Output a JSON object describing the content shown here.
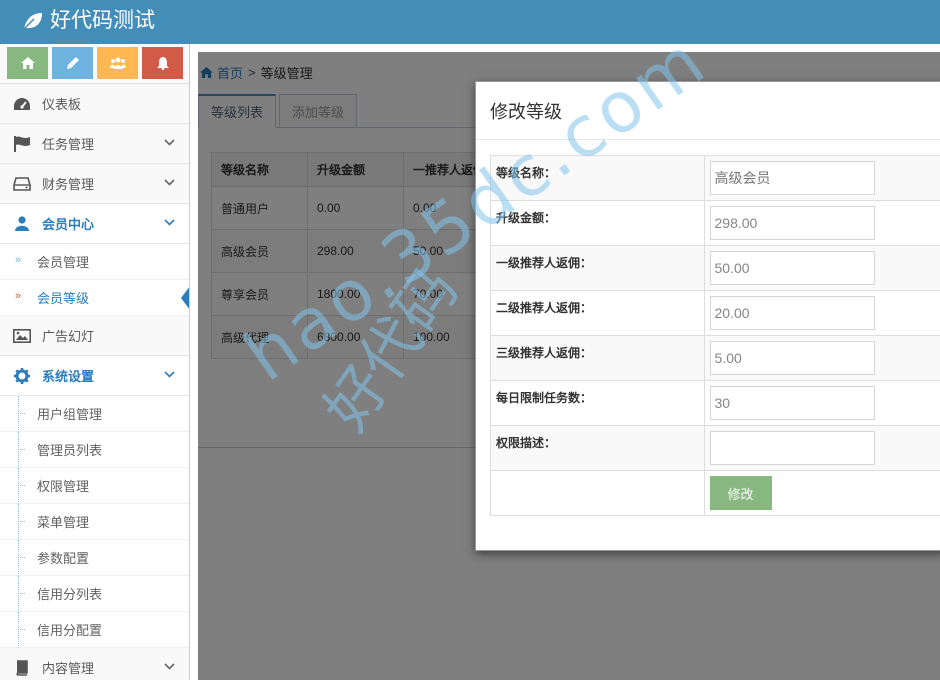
{
  "header": {
    "title": "好代码测试"
  },
  "shortcuts": [
    {
      "icon": "home-icon",
      "color": "#87b87f"
    },
    {
      "icon": "pencil-icon",
      "color": "#6fb3e0"
    },
    {
      "icon": "users-icon",
      "color": "#ffb752"
    },
    {
      "icon": "bell-icon",
      "color": "#d15b47"
    }
  ],
  "sidebar": {
    "dashboard": "仪表板",
    "tasks": "任务管理",
    "finance": "财务管理",
    "members": "会员中心",
    "member_manage": "会员管理",
    "member_level": "会员等级",
    "ads": "广告幻灯",
    "system": "系统设置",
    "system_items": [
      "用户组管理",
      "管理员列表",
      "权限管理",
      "菜单管理",
      "参数配置",
      "信用分列表",
      "信用分配置"
    ],
    "content": "内容管理"
  },
  "breadcrumb": {
    "home": "首页",
    "separator": ">",
    "current": "等级管理"
  },
  "tabs": [
    {
      "label": "等级列表"
    },
    {
      "label": "添加等级"
    }
  ],
  "level_table": {
    "headers": [
      "等级名称",
      "升级金额",
      "一推荐人返佣"
    ],
    "rows": [
      [
        "普通用户",
        "0.00",
        "0.00"
      ],
      [
        "高级会员",
        "298.00",
        "50.00"
      ],
      [
        "尊享会员",
        "1800.00",
        "70.00"
      ],
      [
        "高级代理",
        "6800.00",
        "100.00"
      ]
    ]
  },
  "modal": {
    "title": "修改等级",
    "fields": [
      {
        "label": "等级名称：",
        "value": "高级会员"
      },
      {
        "label": "升级金额：",
        "value": "298.00"
      },
      {
        "label": "一级推荐人返佣：",
        "value": "50.00"
      },
      {
        "label": "二级推荐人返佣：",
        "value": "20.00"
      },
      {
        "label": "三级推荐人返佣：",
        "value": "5.00"
      },
      {
        "label": "每日限制任务数：",
        "value": "30"
      },
      {
        "label": "权限描述：",
        "value": ""
      }
    ],
    "submit": "修改"
  },
  "watermark": {
    "text1": "hao.35dc.com",
    "text2": "好代码"
  }
}
